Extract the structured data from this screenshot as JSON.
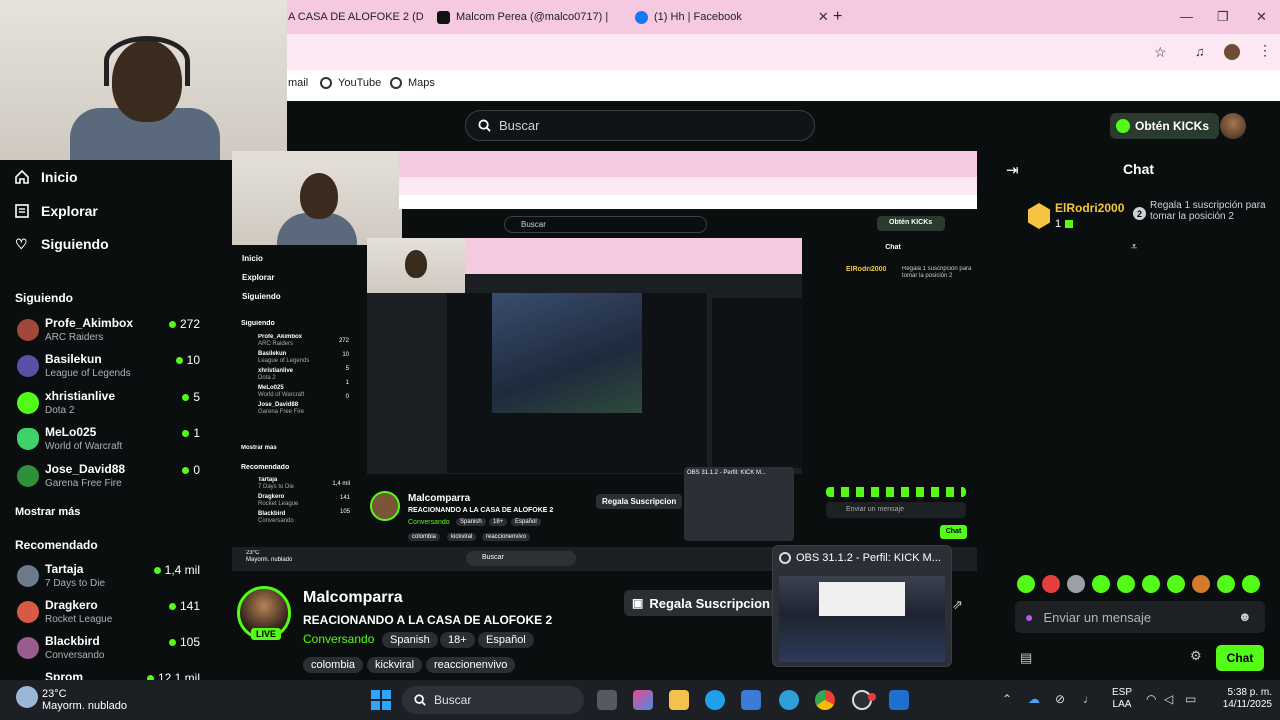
{
  "browser": {
    "tabs": [
      {
        "label": "A CASA DE ALOFOKE 2 (D"
      },
      {
        "label": "Malcom Perea (@malco0717) |"
      },
      {
        "label": "(1) Hh | Facebook"
      }
    ],
    "bookmarks": [
      {
        "label": "mail"
      },
      {
        "label": "YouTube"
      },
      {
        "label": "Maps"
      }
    ]
  },
  "header": {
    "search_placeholder": "Buscar",
    "kicks_label": "Obtén KICKs"
  },
  "sidebar": {
    "nav": [
      {
        "label": "Inicio"
      },
      {
        "label": "Explorar"
      },
      {
        "label": "Siguiendo"
      }
    ],
    "following_title": "Siguiendo",
    "following": [
      {
        "name": "Profe_Akimbox",
        "game": "ARC Raiders",
        "viewers": "272"
      },
      {
        "name": "Basilekun",
        "game": "League of Legends",
        "viewers": "10"
      },
      {
        "name": "xhristianlive",
        "game": "Dota 2",
        "viewers": "5"
      },
      {
        "name": "MeLo025",
        "game": "World of Warcraft",
        "viewers": "1"
      },
      {
        "name": "Jose_David88",
        "game": "Garena Free Fire",
        "viewers": "0"
      }
    ],
    "show_more": "Mostrar más",
    "recommended_title": "Recomendado",
    "recommended": [
      {
        "name": "Tartaja",
        "game": "7 Days to Die",
        "viewers": "1,4 mil"
      },
      {
        "name": "Dragkero",
        "game": "Rocket League",
        "viewers": "141"
      },
      {
        "name": "Blackbird",
        "game": "Conversando",
        "viewers": "105"
      },
      {
        "name": "Sprom",
        "game": "",
        "viewers": "12,1 mil"
      }
    ]
  },
  "channel": {
    "name": "Malcomparra",
    "title": "REACIONANDO A LA CASA DE ALOFOKE 2",
    "category": "Conversando",
    "badges": [
      "Spanish",
      "18+",
      "Español"
    ],
    "tags": [
      "colombia",
      "kickviral",
      "reaccionenvivo"
    ],
    "live": "LIVE",
    "gift_label": "Regala Suscripcion"
  },
  "obs": {
    "title": "OBS 31.1.2 - Perfil: KICK  M..."
  },
  "chat": {
    "title": "Chat",
    "top_gifter": {
      "name": "ElRodri2000",
      "count": "1",
      "rank": "2",
      "text": "Regala 1 suscripción para tomar la posición 2"
    },
    "input_placeholder": "Enviar un mensaje",
    "send_label": "Chat"
  },
  "taskbar": {
    "weather_temp": "23°C",
    "weather_desc": "Mayorm. nublado",
    "search_placeholder": "Buscar",
    "lang_1": "ESP",
    "lang_2": "LAA",
    "time": "5:38 p. m.",
    "date": "14/11/2025"
  },
  "nested": {
    "search": "Buscar",
    "kicks": "Obtén KICKs",
    "chat": "Chat",
    "gifter": "ElRodri2000",
    "gifter_text": "Regala 1 suscripción para tomar la posición 2",
    "nav": [
      "Inicio",
      "Explorar",
      "Siguiendo"
    ],
    "following_title": "Siguiendo",
    "following": [
      {
        "name": "Profe_Akimbox",
        "game": "ARC Raiders",
        "viewers": "272"
      },
      {
        "name": "Basilekun",
        "game": "League of Legends",
        "viewers": "10"
      },
      {
        "name": "xhristianlive",
        "game": "Dota 2",
        "viewers": "5"
      },
      {
        "name": "MeLo025",
        "game": "World of Warcraft",
        "viewers": "1"
      },
      {
        "name": "Jose_David88",
        "game": "Garena Free Fire",
        "viewers": "0"
      }
    ],
    "show_more": "Mostrar más",
    "recommended_title": "Recomendado",
    "recommended": [
      {
        "name": "Tartaja",
        "game": "7 Days to Die",
        "viewers": "1,4 mil"
      },
      {
        "name": "Dragkero",
        "game": "Rocket League",
        "viewers": "141"
      },
      {
        "name": "Blackbird",
        "game": "Conversando",
        "viewers": "105"
      }
    ],
    "channel_name": "Malcomparra",
    "channel_title": "REACIONANDO A LA CASA DE ALOFOKE 2",
    "category": "Conversando",
    "badges": [
      "Spanish",
      "18+",
      "Español"
    ],
    "tags": [
      "colombia",
      "kickviral",
      "reaccionenvivo"
    ],
    "gift": "Regala Suscripcion",
    "input": "Enviar un mensaje",
    "obs": "OBS 31.1.2 - Perfil: KICK M...",
    "temp": "23°C",
    "weather": "Mayorm. nublado"
  },
  "colors": {
    "accent": "#53fc18",
    "tabbar": "#f5c9e0",
    "background": "#0b0e0f"
  }
}
